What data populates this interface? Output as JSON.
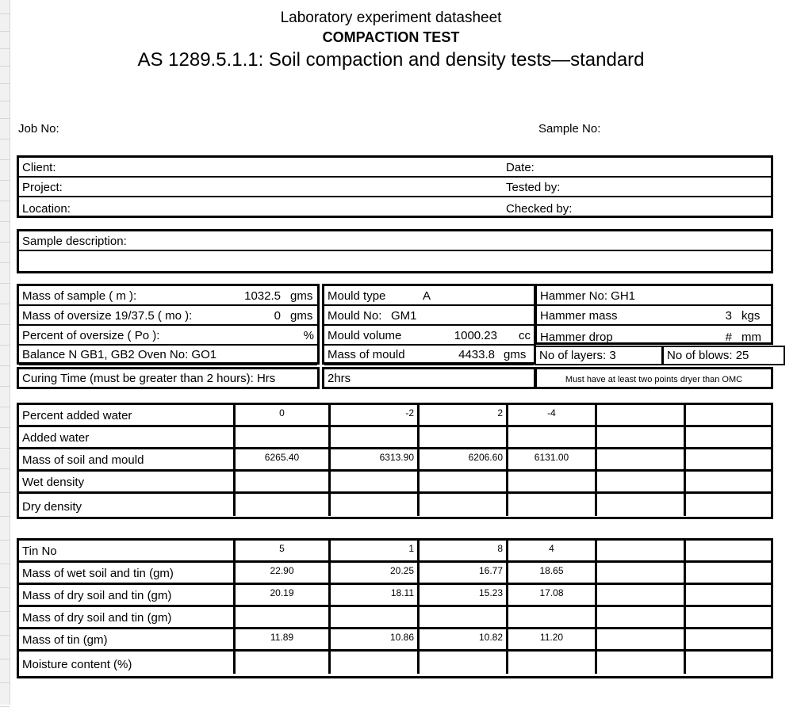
{
  "titles": {
    "line1": "Laboratory experiment datasheet",
    "line2": "COMPACTION TEST",
    "line3": "AS 1289.5.1.1: Soil compaction and density tests—standard"
  },
  "header": {
    "job_no_label": "Job No:",
    "sample_no_label": "Sample No:"
  },
  "client_block": {
    "client_label": "Client:",
    "client_value": "",
    "date_label": "Date:",
    "date_value": "",
    "project_label": "Project:",
    "project_value": "",
    "tested_by_label": "Tested by:",
    "tested_by_value": "",
    "location_label": "Location:",
    "location_value": "",
    "checked_by_label": "Checked by:",
    "checked_by_value": ""
  },
  "sample_description": {
    "label": "Sample description:",
    "value": "",
    "line2": ""
  },
  "details": {
    "left": [
      {
        "label": "Mass of sample ( m ):",
        "value": "1032.5",
        "unit": "gms"
      },
      {
        "label": "Mass of oversize 19/37.5 ( mo ):",
        "value": "0",
        "unit": "gms"
      },
      {
        "label": "Percent of oversize ( Po ):",
        "value": "",
        "unit": "%"
      },
      {
        "label": "Balance N GB1, GB2   Oven No:   GO1",
        "value": "",
        "unit": ""
      },
      {
        "label": "Curing Time (must be greater than 2 hours): Hrs",
        "value": "",
        "unit": ""
      }
    ],
    "middle": [
      {
        "label": "Mould type",
        "value": "A",
        "unit": ""
      },
      {
        "label": "Mould No:",
        "value": "GM1",
        "unit": ""
      },
      {
        "label": "Mould volume",
        "value": "1000.23",
        "unit": "cc"
      },
      {
        "label": "Mass of mould",
        "value": "4433.8",
        "unit": "gms"
      },
      {
        "label": "2hrs",
        "value": "",
        "unit": ""
      }
    ],
    "right": [
      {
        "label": "Hammer No: GH1",
        "value": "",
        "unit": ""
      },
      {
        "label": "Hammer mass",
        "value": "3",
        "unit": "kgs"
      },
      {
        "label": "Hammer drop",
        "value": "#",
        "unit": "mm"
      }
    ],
    "layers_label": "No of layers: 3",
    "blows_label": "No of blows: 25",
    "note": "Must have at least two points dryer than OMC"
  },
  "density_table": {
    "rows": [
      {
        "label": "Percent  added water",
        "values": [
          "0",
          "-2",
          "2",
          "-4",
          "",
          ""
        ]
      },
      {
        "label": " Added water",
        "values": [
          "",
          "",
          "",
          "",
          "",
          ""
        ]
      },
      {
        "label": "Mass of soil and mould",
        "values": [
          "6265.40",
          "6313.90",
          "6206.60",
          "6131.00",
          "",
          ""
        ]
      },
      {
        "label": "Wet density",
        "values": [
          "",
          "",
          "",
          "",
          "",
          ""
        ]
      },
      {
        "label": "Dry density",
        "values": [
          "",
          "",
          "",
          "",
          "",
          ""
        ]
      }
    ]
  },
  "moisture_table": {
    "rows": [
      {
        "label": "Tin No",
        "values": [
          "5",
          "1",
          "8",
          "4",
          "",
          ""
        ]
      },
      {
        "label": "Mass of wet soil and tin (gm)",
        "values": [
          "22.90",
          "20.25",
          "16.77",
          "18.65",
          "",
          ""
        ]
      },
      {
        "label": "Mass of dry soil and tin (gm)",
        "values": [
          "20.19",
          "18.11",
          "15.23",
          "17.08",
          "",
          ""
        ]
      },
      {
        "label": "Mass of dry soil and tin (gm)",
        "values": [
          "",
          "",
          "",
          "",
          "",
          ""
        ]
      },
      {
        "label": "Mass of tin (gm)",
        "values": [
          "11.89",
          "10.86",
          "10.82",
          "11.20",
          "",
          ""
        ]
      },
      {
        "label": "Moisture content (%)",
        "values": [
          "",
          "",
          "",
          "",
          "",
          ""
        ]
      }
    ]
  }
}
